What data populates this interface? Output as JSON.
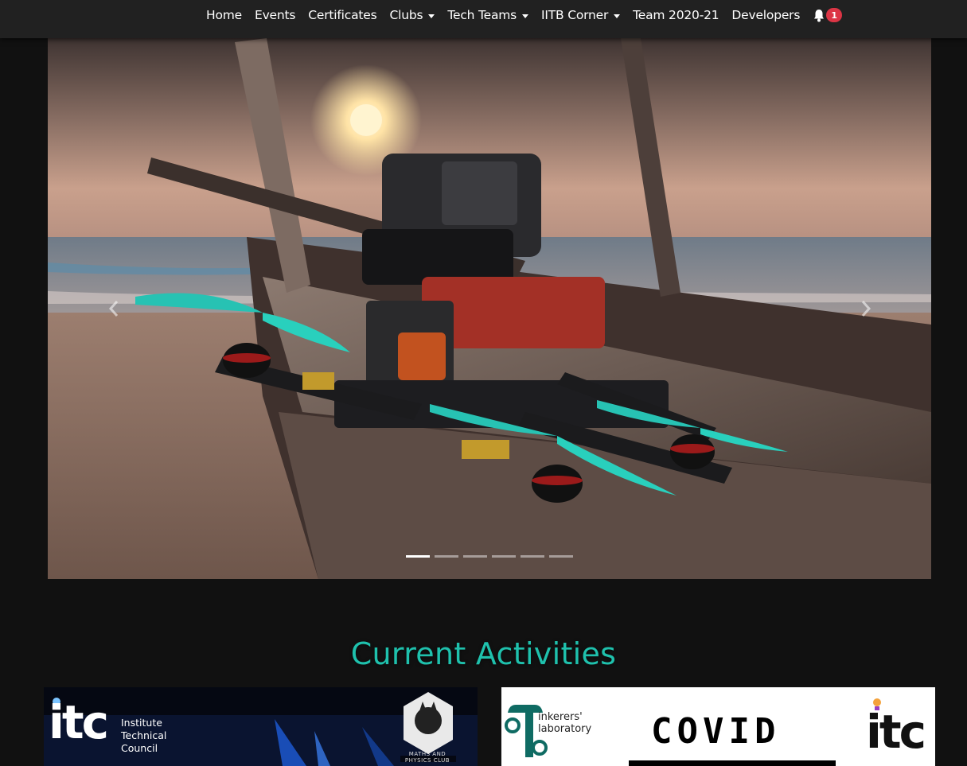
{
  "nav": {
    "items": [
      {
        "label": "Home",
        "dropdown": false
      },
      {
        "label": "Events",
        "dropdown": false
      },
      {
        "label": "Certificates",
        "dropdown": false
      },
      {
        "label": "Clubs",
        "dropdown": true
      },
      {
        "label": "Tech Teams",
        "dropdown": true
      },
      {
        "label": "IITB Corner",
        "dropdown": true
      },
      {
        "label": "Team 2020-21",
        "dropdown": false
      },
      {
        "label": "Developers",
        "dropdown": false
      }
    ],
    "notification_icon": "bell-icon",
    "notification_count": "1"
  },
  "carousel": {
    "slide_count": 6,
    "active_index": 0,
    "prev_icon": "chevron-left-icon",
    "next_icon": "chevron-right-icon"
  },
  "section": {
    "title": "Current Activities"
  },
  "cards": [
    {
      "logo_text": "itc",
      "org_line1": "Institute",
      "org_line2": "Technical",
      "org_line3": "Council",
      "badge_text": "MATHS AND PHYSICS CLUB"
    },
    {
      "partner_line1": "inkerers'",
      "partner_line2": "laboratory",
      "headline": "COVID",
      "logo_text": "itc"
    }
  ],
  "colors": {
    "accent": "#1fc1ad",
    "navbar": "#212121",
    "badge": "#dc3545",
    "background": "#111111"
  }
}
